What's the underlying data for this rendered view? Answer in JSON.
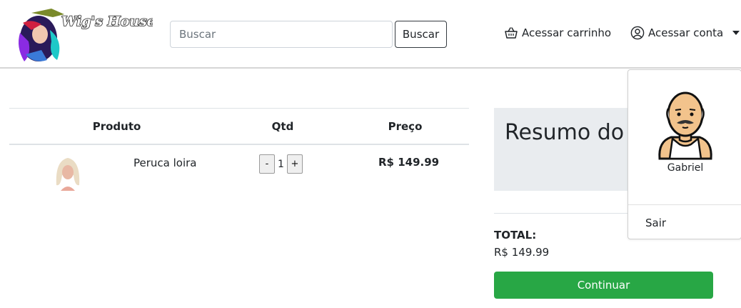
{
  "header": {
    "logo_text": "Wig's House",
    "search": {
      "placeholder": "Buscar",
      "value": ""
    },
    "search_button_label": "Buscar",
    "cart_link_label": "Acessar carrinho",
    "account_link_label": "Acessar conta"
  },
  "cart": {
    "columns": [
      "Produto",
      "Qtd",
      "Preço"
    ],
    "items": [
      {
        "name": "Peruca loira",
        "quantity": "1",
        "price": "R$ 149.99"
      }
    ],
    "decrement_label": "-",
    "increment_label": "+"
  },
  "summary": {
    "title": "Resumo do Pedido",
    "total_label": "TOTAL:",
    "total_value": "R$ 149.99",
    "continue_label": "Continuar"
  },
  "account_menu": {
    "user_name": "Gabriel",
    "logout_label": "Sair"
  },
  "colors": {
    "continue_green": "#28a745",
    "summary_bg": "#e9ecef"
  }
}
